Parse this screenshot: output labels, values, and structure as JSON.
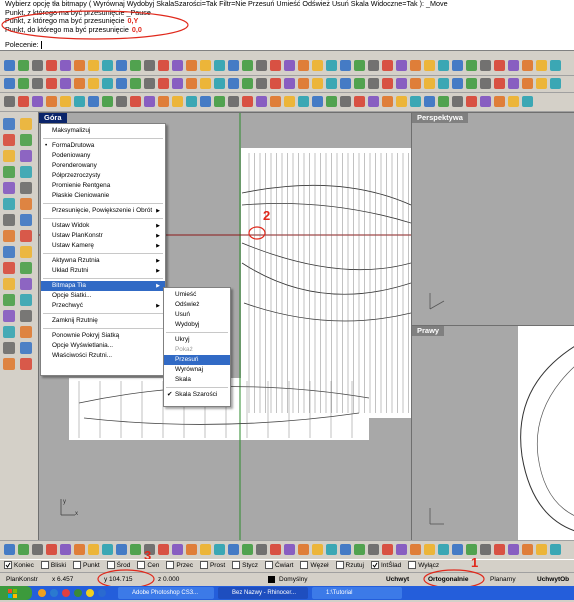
{
  "command": {
    "lines": [
      "Wybierz opcję tła bitmapy ( Wyrównaj  Wydobyj  SkalaSzarości=Tak Filtr=Nie Przesuń  Umieść  Odśwież  Usuń  Skala  Widoczne=Tak ):  _Move",
      "Punkt, z którego ma być przesunięcie  _Pause",
      "Punkt, z którego ma być przesunięcie",
      "Punkt, do którego ma być przesunięcie"
    ],
    "annot_1": "0,Y",
    "annot_2": "0,0",
    "prompt_label": "Polecenie:"
  },
  "viewports": {
    "top": {
      "title": "Góra"
    },
    "perspective": {
      "title": "Perspektywa"
    },
    "right": {
      "title": "Prawy"
    }
  },
  "context_menu": {
    "items": [
      {
        "label": "Maksymalizuj"
      },
      {
        "label": "FormaDrutowa",
        "bullet": true
      },
      {
        "label": "Podeniowany"
      },
      {
        "label": "Porenderowany"
      },
      {
        "label": "Półprzezroczysty"
      },
      {
        "label": "Promienie Rentgena"
      },
      {
        "label": "Płaskie Cieniowanie"
      },
      {
        "label": "Przesunięcie, Powiększenie i Obrót",
        "arrow": true
      },
      {
        "label": "Ustaw Widok",
        "arrow": true
      },
      {
        "label": "Ustaw PlanKonstr",
        "arrow": true
      },
      {
        "label": "Ustaw Kamerę",
        "arrow": true
      },
      {
        "label": "Aktywna Rzutnia",
        "arrow": true
      },
      {
        "label": "Układ Rzutni",
        "arrow": true
      },
      {
        "label": "Bitmapa Tła",
        "arrow": true
      },
      {
        "label": "Opcje Siatki..."
      },
      {
        "label": "Przechwyć",
        "arrow": true
      },
      {
        "label": "Zamknij Rzutnię"
      },
      {
        "label": "Ponownie Pokryj Siatką"
      },
      {
        "label": "Opcje Wyświetlania..."
      },
      {
        "label": "Właściwości Rzutni..."
      }
    ]
  },
  "submenu": {
    "items": [
      {
        "label": "Umieść"
      },
      {
        "label": "Odśwież"
      },
      {
        "label": "Usuń"
      },
      {
        "label": "Wydobyj"
      },
      {
        "label": "Ukryj"
      },
      {
        "label": "Pokaż"
      },
      {
        "label": "Przesuń"
      },
      {
        "label": "Wyrównaj"
      },
      {
        "label": "Skala"
      },
      {
        "label": "Skala Szarości",
        "checked": true
      }
    ]
  },
  "markers": {
    "m1": "1",
    "m2": "2",
    "m3": "3"
  },
  "osnap": {
    "items": [
      "Koniec",
      "Bliski",
      "Punkt",
      "Środ",
      "Cen",
      "Przec",
      "Prost",
      "Stycz",
      "Ćwiart",
      "Węzeł",
      "Rzutuj",
      "IntŚlad",
      "Wyłącz"
    ],
    "checked": [
      "Koniec",
      "IntŚlad"
    ]
  },
  "status": {
    "cplane": "PlanKonstr",
    "x": "x 6.457",
    "y": "y 104.715",
    "z": "z 0.000",
    "layer": "Domyślny",
    "snap": "Uchwyt",
    "ortho": "Ortogonalnie",
    "planar": "Planarny",
    "osnap": "UchwytOb"
  },
  "taskbar": {
    "items": [
      "Adobe Photoshop CS3...",
      "Bez Nazwy - Rhinocer...",
      "1:\\Tutorial"
    ]
  },
  "colors": {
    "accent_red": "#e0281b",
    "menu_select": "#316ac5",
    "viewport_title_active": "#0a246a"
  }
}
